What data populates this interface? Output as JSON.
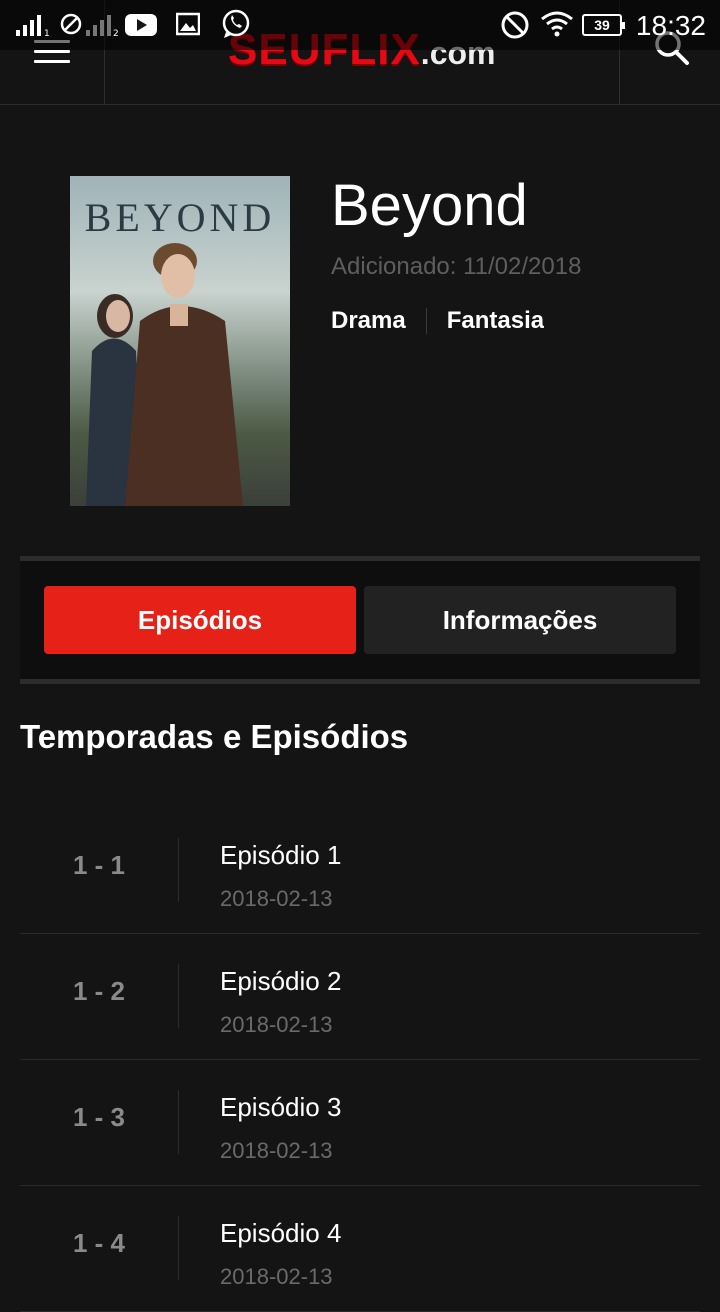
{
  "status_bar": {
    "time": "18:32",
    "battery": "39",
    "icons": [
      "signal-icon",
      "no-sim-icon",
      "signal-2-icon",
      "youtube-icon",
      "gallery-icon",
      "whatsapp-icon",
      "do-not-disturb-icon",
      "wifi-icon",
      "battery-icon"
    ]
  },
  "header": {
    "brand_name": "SEUFLIX",
    "brand_tld": ".com",
    "menu_icon": "hamburger-menu-icon",
    "search_icon": "search-icon"
  },
  "show": {
    "title": "Beyond",
    "poster_title": "BEYOND",
    "added": "Adicionado: 11/02/2018",
    "genres": [
      "Drama",
      "Fantasia"
    ]
  },
  "tabs": {
    "episodes": "Episódios",
    "info": "Informações",
    "active": "episodes"
  },
  "episodes_section": {
    "title": "Temporadas e Episódios",
    "items": [
      {
        "number": "1 - 1",
        "title": "Episódio 1",
        "date": "2018-02-13"
      },
      {
        "number": "1 - 2",
        "title": "Episódio 2",
        "date": "2018-02-13"
      },
      {
        "number": "1 - 3",
        "title": "Episódio 3",
        "date": "2018-02-13"
      },
      {
        "number": "1 - 4",
        "title": "Episódio 4",
        "date": "2018-02-13"
      }
    ]
  },
  "colors": {
    "background": "#141414",
    "accent": "#e62117",
    "inactive_tab": "#222222",
    "muted_text": "#5e5e5e"
  }
}
